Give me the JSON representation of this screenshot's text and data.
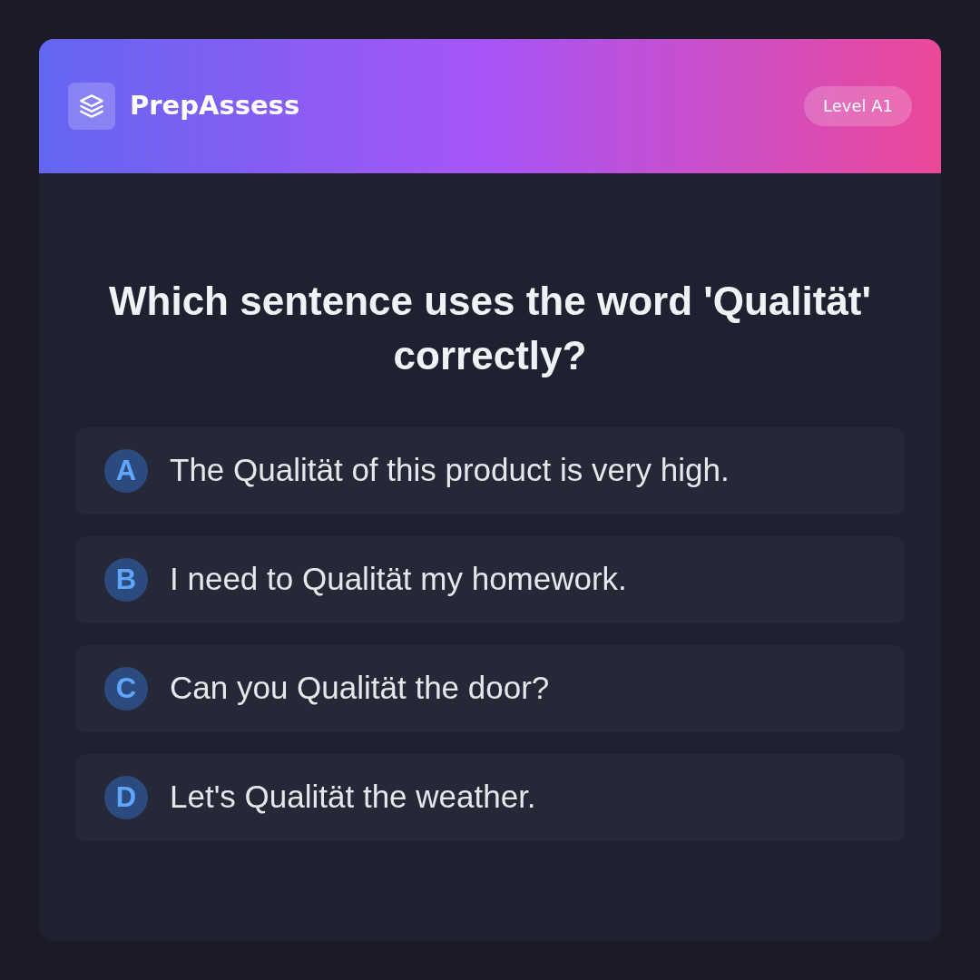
{
  "header": {
    "title": "PrepAssess",
    "badge": "Level A1"
  },
  "question": "Which sentence uses the word 'Qualität' correctly?",
  "options": [
    {
      "letter": "A",
      "text": "The Qualität of this product is very high."
    },
    {
      "letter": "B",
      "text": "I need to Qualität my homework."
    },
    {
      "letter": "C",
      "text": "Can you Qualität the door?"
    },
    {
      "letter": "D",
      "text": "Let's Qualität the weather."
    }
  ]
}
